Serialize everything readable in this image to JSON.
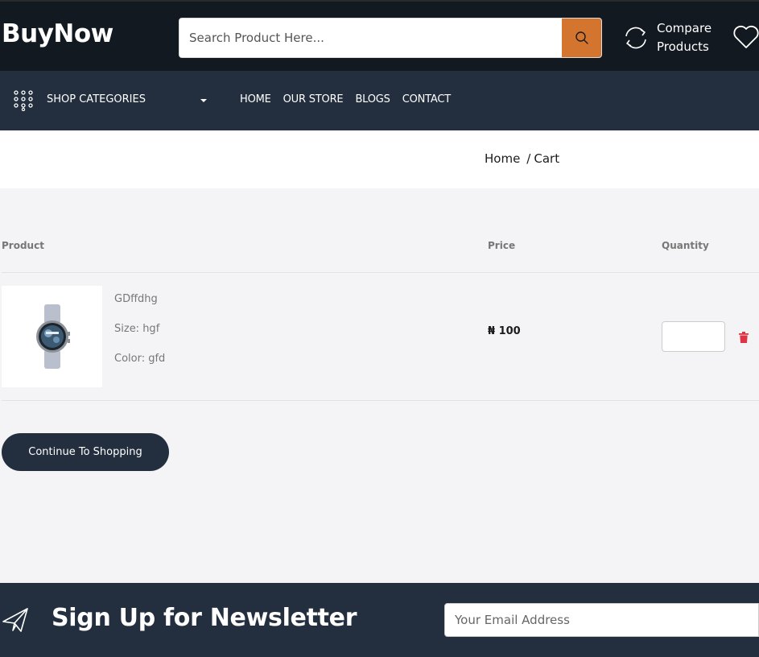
{
  "header": {
    "logo": "BuyNow",
    "search_placeholder": "Search Product Here...",
    "compare_line1": "Compare",
    "compare_line2": "Products",
    "accent_color": "#d3752f"
  },
  "nav": {
    "categories_label": "SHOP CATEGORIES",
    "links": [
      "HOME",
      "OUR STORE",
      "BLOGS",
      "CONTACT"
    ]
  },
  "breadcrumb": {
    "home": "Home",
    "separator": "/",
    "current": "Cart"
  },
  "cart": {
    "columns": {
      "product": "Product",
      "price": "Price",
      "quantity": "Quantity"
    },
    "items": [
      {
        "name": "GDffdhg",
        "size": "Size: hgf",
        "color": "Color: gfd",
        "price": "₦ 100",
        "quantity": "",
        "image": "smartwatch-image"
      }
    ],
    "continue_label": "Continue To Shopping"
  },
  "newsletter": {
    "title": "Sign Up for Newsletter",
    "email_placeholder": "Your Email Address"
  }
}
